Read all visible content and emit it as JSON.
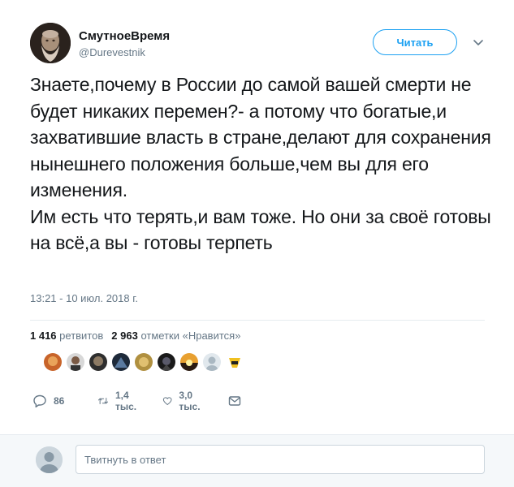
{
  "author": {
    "name": "СмутноеВремя",
    "handle": "@Durevestnik"
  },
  "follow_button": {
    "label": "Читать"
  },
  "tweet": {
    "text": "Знаете,почему в России до самой вашей смерти не будет никаких перемен?- а потому что богатые,и захватившие власть в стране,делают для сохранения нынешнего положения больше,чем вы для его изменения.\nИм есть что терять,и вам тоже. Но они за своё готовы на всё,а вы - готовы терпеть",
    "timestamp": "13:21 - 10 июл. 2018 г."
  },
  "stats": {
    "retweets_count": "1 416",
    "retweets_label": "ретвитов",
    "likes_count": "2 963",
    "likes_label": "отметки «Нравится»"
  },
  "actions": {
    "replies": "86",
    "retweets": "1,4 тыс.",
    "likes": "3,0 тыс."
  },
  "reply": {
    "placeholder": "Твитнуть в ответ"
  },
  "colors": {
    "accent": "#1da1f2",
    "secondary_text": "#657786",
    "divider": "#e6ecf0"
  }
}
